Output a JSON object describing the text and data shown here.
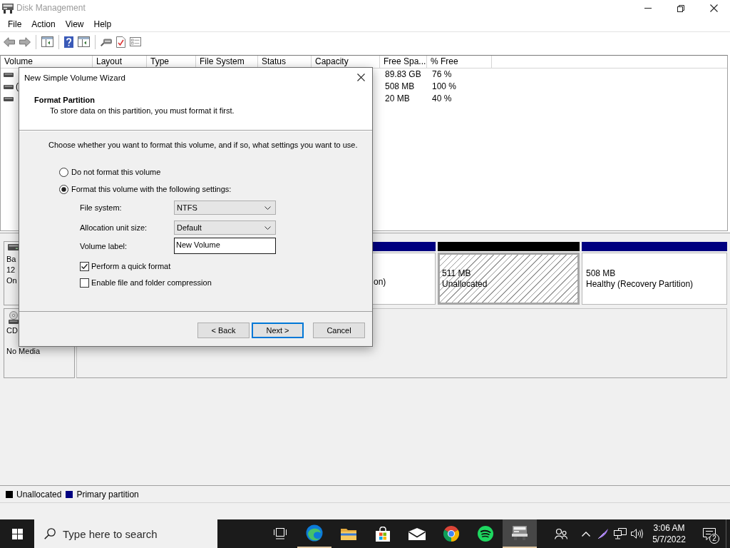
{
  "window": {
    "title": "Disk Management"
  },
  "menu": [
    "File",
    "Action",
    "View",
    "Help"
  ],
  "volume_list": {
    "columns": [
      "Volume",
      "Layout",
      "Type",
      "File System",
      "Status",
      "Capacity",
      "Free Spa...",
      "% Free"
    ],
    "rows": [
      {
        "free_space": "89.83 GB",
        "percent_free": "76 %"
      },
      {
        "volume": "(",
        "free_space": "508 MB",
        "percent_free": "100 %"
      },
      {
        "free_space": "20 MB",
        "percent_free": "40 %"
      }
    ]
  },
  "disks": [
    {
      "kind": "disk",
      "info": [
        "Ba",
        "12",
        "On"
      ],
      "partitions": [
        {
          "kind": "primary",
          "selected": false,
          "lines": [
            "on)"
          ]
        },
        {
          "kind": "unallocated",
          "selected": true,
          "lines": [
            "511 MB",
            "Unallocated"
          ]
        },
        {
          "kind": "primary",
          "selected": false,
          "lines": [
            "508 MB",
            "Healthy (Recovery Partition)"
          ]
        }
      ]
    },
    {
      "kind": "cdrom",
      "info": [
        "CD"
      ],
      "media": "No Media"
    }
  ],
  "legend": [
    {
      "label": "Unallocated",
      "color": "#000000"
    },
    {
      "label": "Primary partition",
      "color": "#000080"
    }
  ],
  "dialog": {
    "title": "New Simple Volume Wizard",
    "heading": "Format Partition",
    "subheading": "To store data on this partition, you must format it first.",
    "instruction": "Choose whether you want to format this volume, and if so, what settings you want to use.",
    "options": [
      {
        "label": "Do not format this volume",
        "selected": false
      },
      {
        "label": "Format this volume with the following settings:",
        "selected": true
      }
    ],
    "fields": [
      {
        "kind": "dropdown",
        "label": "File system:",
        "value": "NTFS"
      },
      {
        "kind": "dropdown",
        "label": "Allocation unit size:",
        "value": "Default"
      },
      {
        "kind": "text",
        "label": "Volume label:",
        "value": "New Volume"
      }
    ],
    "checkboxes": [
      {
        "label": "Perform a quick format",
        "checked": true
      },
      {
        "label": "Enable file and folder compression",
        "checked": false
      }
    ],
    "buttons": [
      {
        "label": "< Back",
        "default": false
      },
      {
        "label": "Next >",
        "default": true
      },
      {
        "label": "Cancel",
        "default": false
      }
    ]
  },
  "taskbar": {
    "search": {
      "placeholder": "Type here to search"
    },
    "apps": [
      {
        "running": true,
        "active": false
      },
      {
        "running": false,
        "active": false
      },
      {
        "running": false,
        "active": false
      },
      {
        "running": false,
        "active": false
      },
      {
        "running": false,
        "active": false
      },
      {
        "running": false,
        "active": false
      },
      {
        "running": true,
        "active": true
      }
    ],
    "clock": {
      "time": "3:06 AM",
      "date": "5/7/2022"
    },
    "notification_count": "2"
  }
}
